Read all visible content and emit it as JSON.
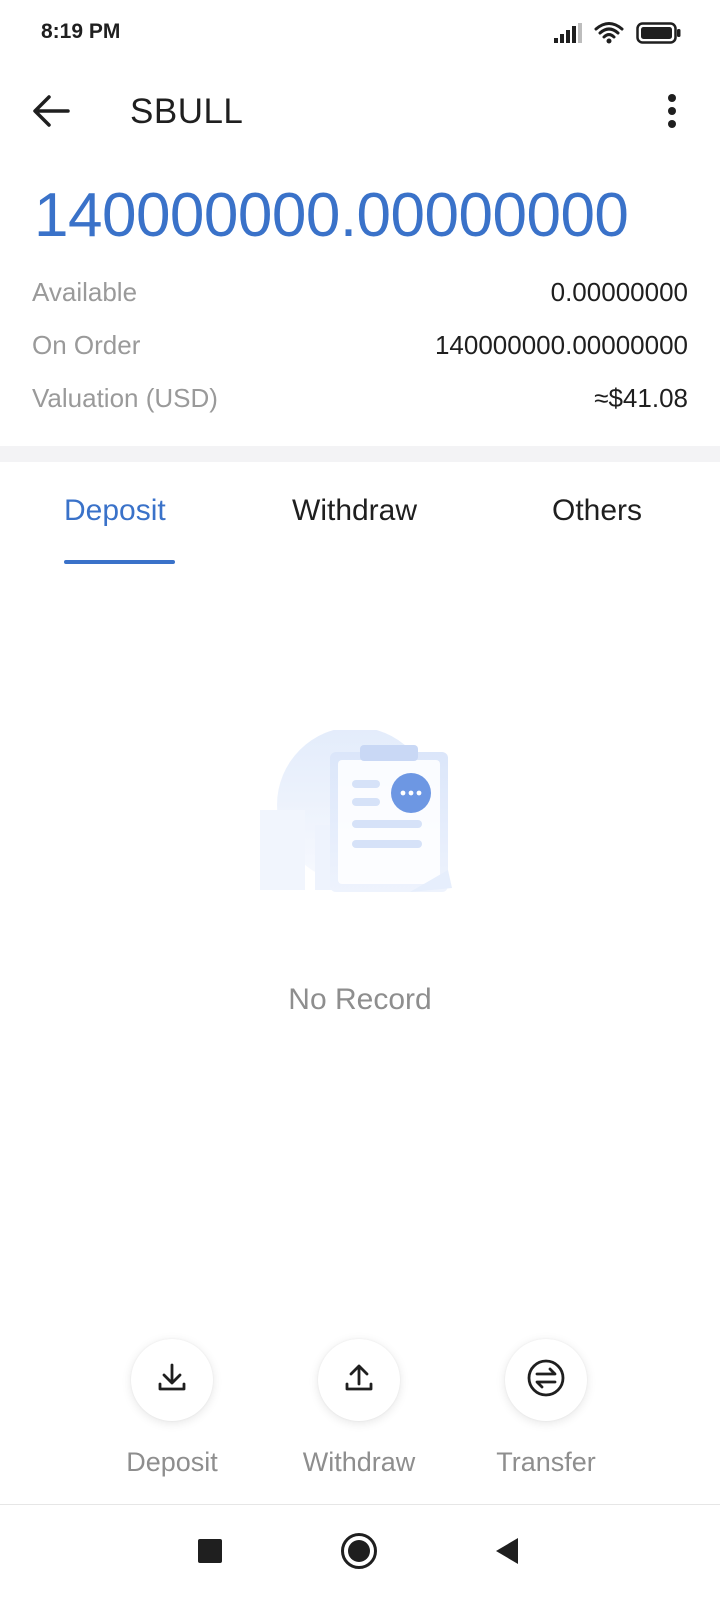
{
  "status_bar": {
    "time": "8:19 PM",
    "icons": [
      "signal-icon",
      "wifi-icon",
      "battery-icon"
    ]
  },
  "header": {
    "title": "SBULL",
    "back_icon": "arrow-left-icon",
    "menu_icon": "more-vertical-icon"
  },
  "balance": {
    "total": "140000000.00000000",
    "rows": [
      {
        "label": "Available",
        "value": "0.00000000"
      },
      {
        "label": "On Order",
        "value": "140000000.00000000"
      },
      {
        "label": "Valuation (USD)",
        "value": "≈$41.08"
      }
    ]
  },
  "tabs": {
    "items": [
      {
        "label": "Deposit",
        "active": true
      },
      {
        "label": "Withdraw",
        "active": false
      },
      {
        "label": "Others",
        "active": false
      }
    ]
  },
  "empty_state": {
    "text": "No Record",
    "icon": "clipboard-document-icon"
  },
  "actions": [
    {
      "label": "Deposit",
      "icon": "download-icon"
    },
    {
      "label": "Withdraw",
      "icon": "upload-icon"
    },
    {
      "label": "Transfer",
      "icon": "transfer-icon"
    }
  ],
  "nav": {
    "items": [
      "recents-square-icon",
      "home-circle-icon",
      "back-triangle-icon"
    ]
  },
  "colors": {
    "accent": "#3a72c9",
    "muted_text": "#9a9a9a",
    "divider": "#f3f3f5"
  }
}
